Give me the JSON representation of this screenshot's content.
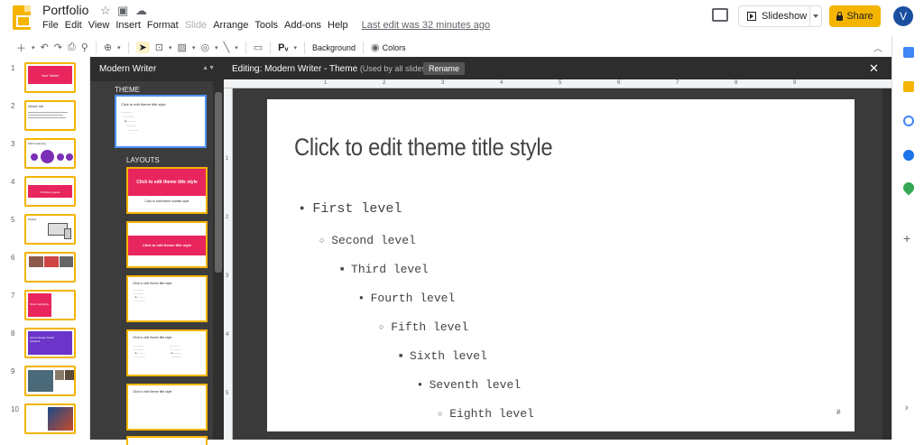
{
  "app": {
    "doc_title": "Portfolio",
    "menu": [
      "File",
      "Edit",
      "View",
      "Insert",
      "Format",
      "Slide",
      "Arrange",
      "Tools",
      "Add-ons",
      "Help"
    ],
    "last_edit": "Last edit was 32 minutes ago",
    "slideshow_label": "Slideshow",
    "share_label": "Share",
    "avatar_letter": "V"
  },
  "toolbar": {
    "background_label": "Background",
    "colors_label": "Colors"
  },
  "filmstrip": {
    "slides": [
      {
        "num": "1",
        "kind": "pink",
        "text": "Your Name"
      },
      {
        "num": "2",
        "kind": "text",
        "text": "About me"
      },
      {
        "num": "3",
        "kind": "circles",
        "text": "Skill & learning"
      },
      {
        "num": "4",
        "kind": "pinkband",
        "text": "Portfolio projects"
      },
      {
        "num": "5",
        "kind": "devices",
        "text": "Project"
      },
      {
        "num": "6",
        "kind": "photos",
        "text": ""
      },
      {
        "num": "7",
        "kind": "pinkbox",
        "text": "Show highlights"
      },
      {
        "num": "8",
        "kind": "purple",
        "text": "Acme Design Award recipient"
      },
      {
        "num": "9",
        "kind": "photos2",
        "text": ""
      },
      {
        "num": "10",
        "kind": "bridge",
        "text": ""
      }
    ]
  },
  "layout_panel": {
    "header": "Modern Writer",
    "theme_label": "THEME",
    "layouts_label": "LAYOUTS",
    "theme_thumb_title": "Click to edit theme title style",
    "layouts": [
      {
        "kind": "title",
        "title": "Click to edit theme title style",
        "sub": "Click to edit theme subtitle style"
      },
      {
        "kind": "band",
        "title": "Click to edit theme title style"
      },
      {
        "kind": "bullets",
        "title": "Click to edit theme title style"
      },
      {
        "kind": "twocol",
        "title": "Click to edit theme title style"
      },
      {
        "kind": "titleonly",
        "title": "Click to edit theme title style"
      }
    ]
  },
  "editor": {
    "heading": "Editing: Modern Writer - Theme",
    "sub": "(Used by all slides)",
    "rename_label": "Rename",
    "ruler_h": [
      "1",
      "2",
      "3",
      "4",
      "5",
      "6",
      "7",
      "8",
      "9"
    ],
    "ruler_v": [
      "1",
      "2",
      "3",
      "4",
      "5"
    ]
  },
  "slide": {
    "title": "Click to edit theme title style",
    "levels": [
      {
        "bullet": "●",
        "text": "First level"
      },
      {
        "bullet": "○",
        "text": "Second level"
      },
      {
        "bullet": "■",
        "text": "Third level"
      },
      {
        "bullet": "●",
        "text": "Fourth level"
      },
      {
        "bullet": "○",
        "text": "Fifth level"
      },
      {
        "bullet": "■",
        "text": "Sixth level"
      },
      {
        "bullet": "●",
        "text": "Seventh level"
      },
      {
        "bullet": "○",
        "text": "Eighth level"
      }
    ],
    "slide_number": "#"
  },
  "colors": {
    "accent": "#f4b400",
    "pink": "#e8255d",
    "purple": "#6a35c8",
    "dark": "#3c3c3c"
  }
}
